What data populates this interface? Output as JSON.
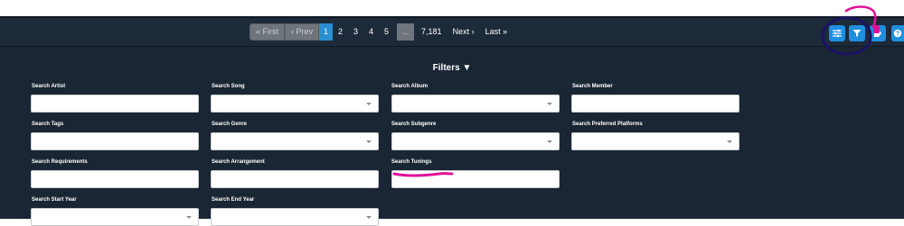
{
  "pagination": {
    "first_label": "« First",
    "prev_label": "‹ Prev",
    "pages": [
      "1",
      "2",
      "3",
      "4",
      "5"
    ],
    "active_page": "1",
    "ellipsis": "...",
    "last_page": "7,181",
    "next_label": "Next ›",
    "last_label": "Last »"
  },
  "toolbar_buttons": [
    {
      "icon": "sliders-icon"
    },
    {
      "icon": "filter-icon"
    },
    {
      "icon": "tag-icon"
    },
    {
      "icon": "help-icon"
    }
  ],
  "filters": {
    "title": "Filters ▼",
    "fields": [
      {
        "label": "Search Artist",
        "type": "text"
      },
      {
        "label": "Search Song",
        "type": "select"
      },
      {
        "label": "Search Album",
        "type": "select"
      },
      {
        "label": "Search Member",
        "type": "text"
      },
      {
        "label": "Search Tags",
        "type": "text"
      },
      {
        "label": "Search Genre",
        "type": "select"
      },
      {
        "label": "Search Subgenre",
        "type": "select"
      },
      {
        "label": "Search Preferred Platforms",
        "type": "select"
      },
      {
        "label": "Search Requirements",
        "type": "text"
      },
      {
        "label": "Search Arrangement",
        "type": "text"
      },
      {
        "label": "Search Tunings",
        "type": "text"
      },
      {
        "label": "Search Start Year",
        "type": "select"
      },
      {
        "label": "Search End Year",
        "type": "select"
      }
    ]
  },
  "colors": {
    "toolbar_bg": "#1d2a3a",
    "panel_bg": "#1a2634",
    "accent": "#1f8fe0",
    "annotation": "#e0119a",
    "circle_annotation": "#1b1361"
  }
}
